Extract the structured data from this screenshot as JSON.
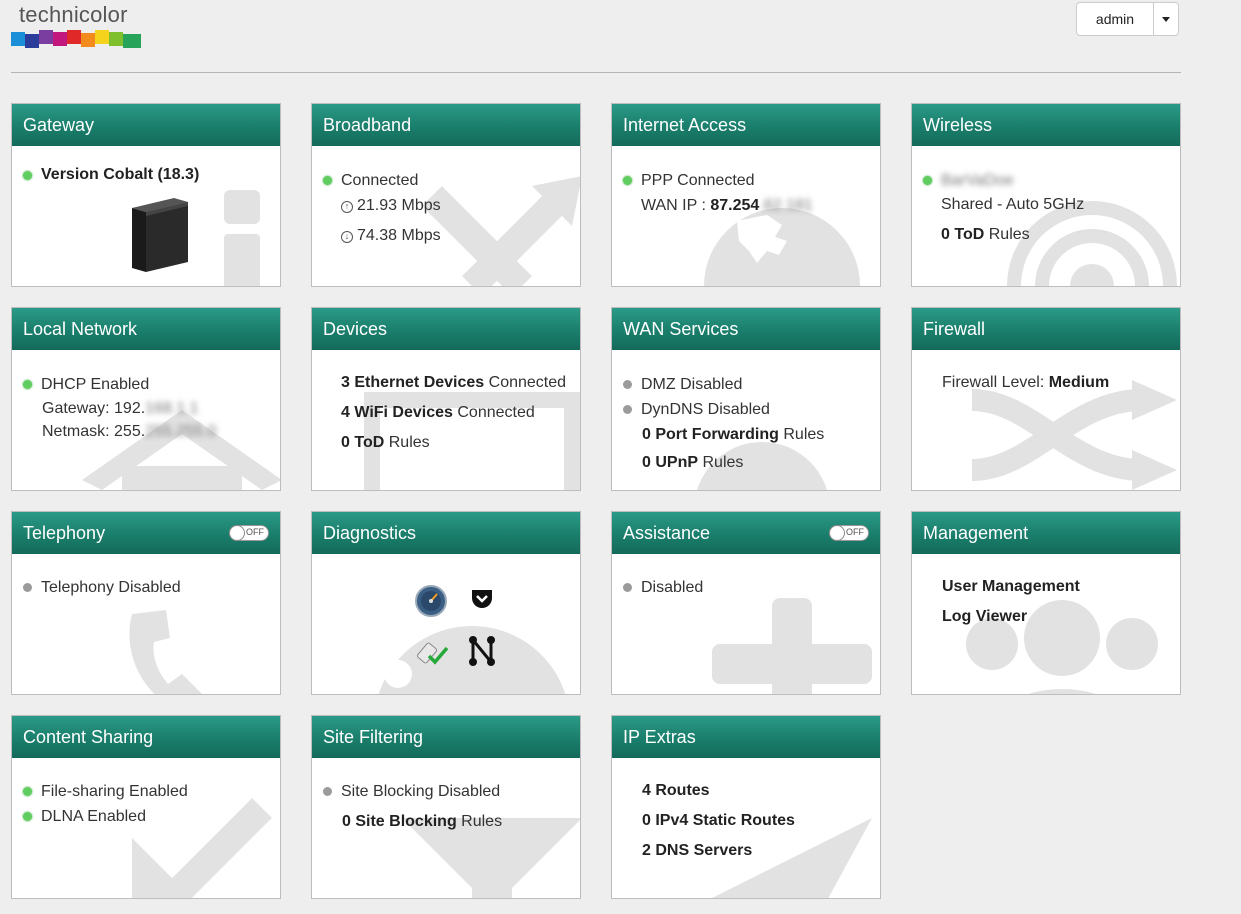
{
  "brand": {
    "name": "technicolor",
    "colors": [
      "#1c8fd9",
      "#2b3c9b",
      "#7a3ea0",
      "#c2177d",
      "#e02828",
      "#f28a1c",
      "#f5d21b",
      "#7fbf2d",
      "#27a35a"
    ]
  },
  "user_menu": {
    "name": "admin"
  },
  "cards": {
    "gateway": {
      "title": "Gateway",
      "version_label": "Version Cobalt (18.3)"
    },
    "broadband": {
      "title": "Broadband",
      "status": "Connected",
      "upload": "21.93 Mbps",
      "download": "74.38 Mbps"
    },
    "internet": {
      "title": "Internet Access",
      "status": "PPP Connected",
      "wan_ip_label": "WAN IP :",
      "wan_ip": "87.254",
      "wan_ip_blur": ".62.181"
    },
    "wireless": {
      "title": "Wireless",
      "ssid_blur": "BarVaDoe",
      "mode": "Shared - Auto 5GHz",
      "tod_count": "0",
      "tod_label": "ToD",
      "rules": "Rules"
    },
    "local_network": {
      "title": "Local Network",
      "dhcp": "DHCP Enabled",
      "gateway_label": "Gateway: 192.",
      "gateway_blur": "168.1.1",
      "netmask_label": "Netmask: 255.",
      "netmask_blur": "255.255.0"
    },
    "devices": {
      "title": "Devices",
      "eth_count": "3",
      "eth_label": "Ethernet Devices",
      "wifi_count": "4",
      "wifi_label": "WiFi Devices",
      "connected": "Connected",
      "tod_count": "0",
      "tod_label": "ToD",
      "rules": "Rules"
    },
    "wan_services": {
      "title": "WAN Services",
      "dmz": "DMZ Disabled",
      "dyndns": "DynDNS Disabled",
      "pf_count": "0",
      "pf_label": "Port Forwarding",
      "upnp_count": "0",
      "upnp_label": "UPnP",
      "rules": "Rules"
    },
    "firewall": {
      "title": "Firewall",
      "level_label": "Firewall Level:",
      "level": "Medium"
    },
    "telephony": {
      "title": "Telephony",
      "toggle": "OFF",
      "status": "Telephony Disabled"
    },
    "diagnostics": {
      "title": "Diagnostics"
    },
    "assistance": {
      "title": "Assistance",
      "toggle": "OFF",
      "status": "Disabled"
    },
    "management": {
      "title": "Management",
      "user_mgmt": "User Management",
      "log_viewer": "Log Viewer"
    },
    "content_sharing": {
      "title": "Content Sharing",
      "file_sharing": "File-sharing Enabled",
      "dlna": "DLNA Enabled"
    },
    "site_filtering": {
      "title": "Site Filtering",
      "status": "Site Blocking Disabled",
      "count": "0",
      "label": "Site Blocking",
      "rules": "Rules"
    },
    "ip_extras": {
      "title": "IP Extras",
      "routes": "4 Routes",
      "static_routes": "0 IPv4 Static Routes",
      "dns": "2 DNS Servers"
    }
  }
}
